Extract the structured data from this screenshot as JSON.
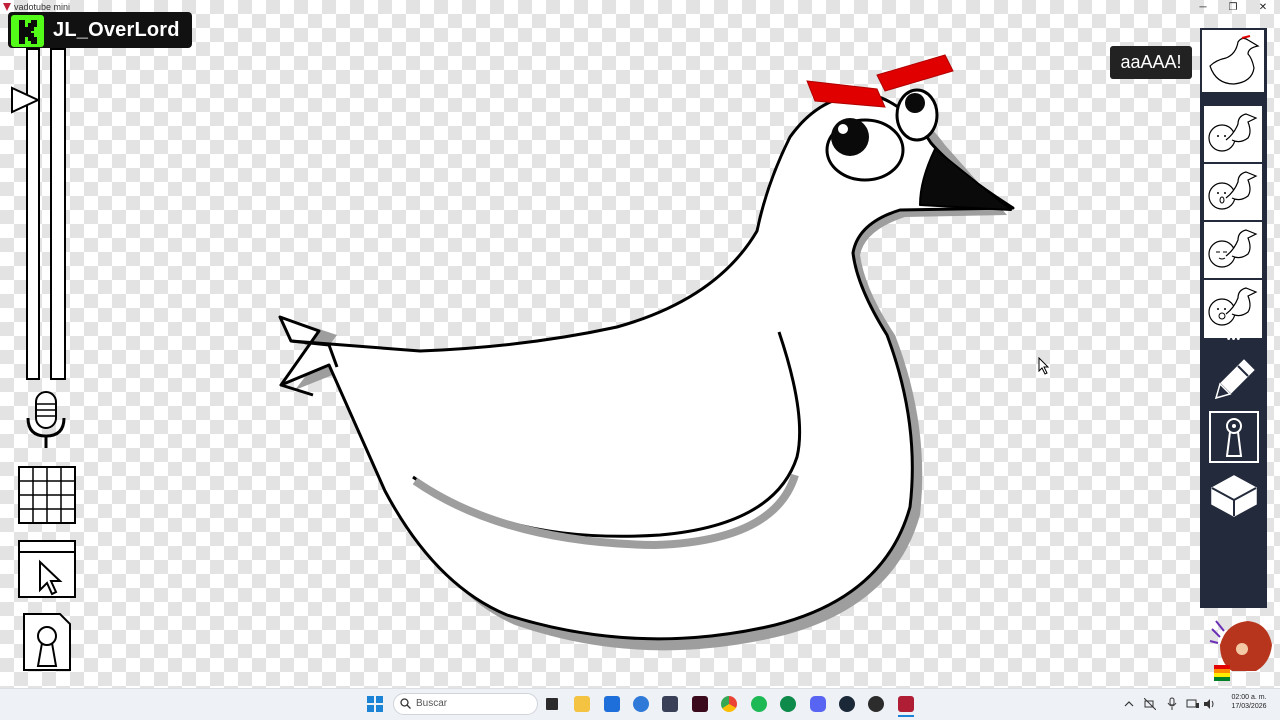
{
  "window": {
    "title": "vadotube mini",
    "minimize_glyph": "─",
    "maximize_glyph": "❐",
    "close_glyph": "✕"
  },
  "streamer": {
    "platform_letter": "K",
    "platform_color": "#53fc18",
    "name": "JL_OverLord"
  },
  "speech": {
    "text": "aaAAA!"
  },
  "left_toolbar": {
    "icons": [
      "play-icon",
      "microphone-icon",
      "grid-icon",
      "window-cursor-icon",
      "keyhole-icon"
    ]
  },
  "right_panel": {
    "more_glyph": "•••",
    "tools": [
      "pencil-icon",
      "keyhole-icon",
      "cube-icon"
    ],
    "color": "#232a3b"
  },
  "taskbar": {
    "search_placeholder": "Buscar",
    "clock_time": "02:00 a. m.",
    "clock_date": "17/03/2026"
  },
  "colors": {
    "eyebrow": "#e00000",
    "beak": "#0a0a0a",
    "body_shadow": "#9e9e9e"
  }
}
